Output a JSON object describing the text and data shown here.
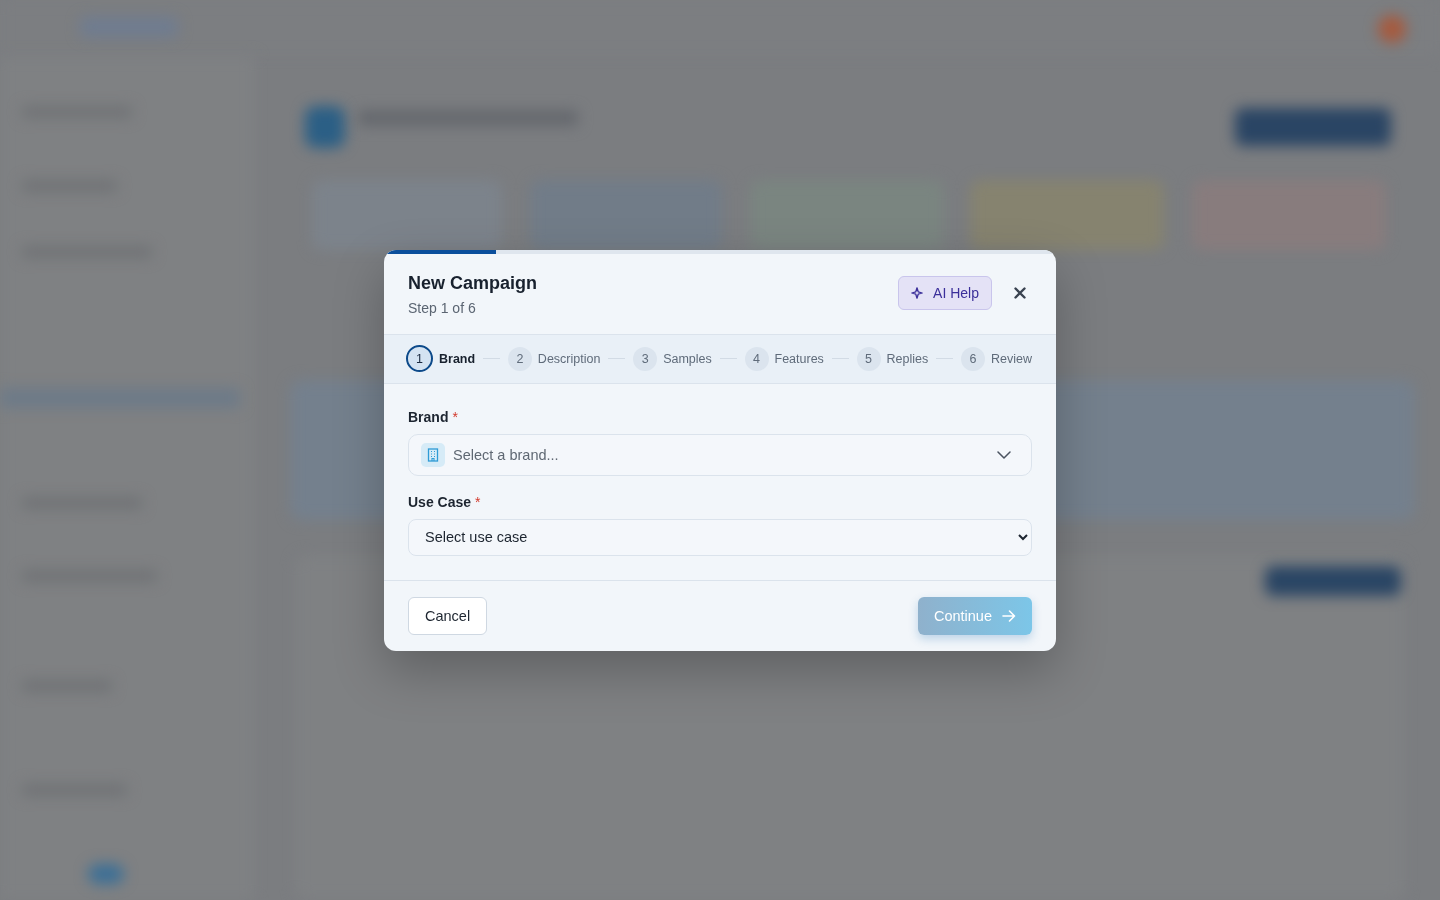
{
  "dialog": {
    "progress": {
      "level": 0.167
    },
    "title": "New Campaign",
    "subtitle": "Step 1 of 6",
    "ai_help_button": {
      "label": "AI Help"
    },
    "steps": [
      {
        "number": "1",
        "label": "Brand",
        "selected": true
      },
      {
        "number": "2",
        "label": "Description",
        "selected": false
      },
      {
        "number": "3",
        "label": "Samples",
        "selected": false
      },
      {
        "number": "4",
        "label": "Features",
        "selected": false
      },
      {
        "number": "5",
        "label": "Replies",
        "selected": false
      },
      {
        "number": "6",
        "label": "Review",
        "selected": false
      }
    ],
    "fields": [
      {
        "kind": "combobox",
        "label": "Brand",
        "required_mark": "*",
        "placeholder": "Select a brand..."
      },
      {
        "kind": "select",
        "label": "Use Case",
        "required_mark": "*",
        "value": "Select use case"
      }
    ],
    "buttons": [
      {
        "kind": "secondary",
        "label": "Cancel",
        "disabled": false
      },
      {
        "kind": "primary",
        "label": "Continue",
        "disabled": true
      }
    ]
  }
}
